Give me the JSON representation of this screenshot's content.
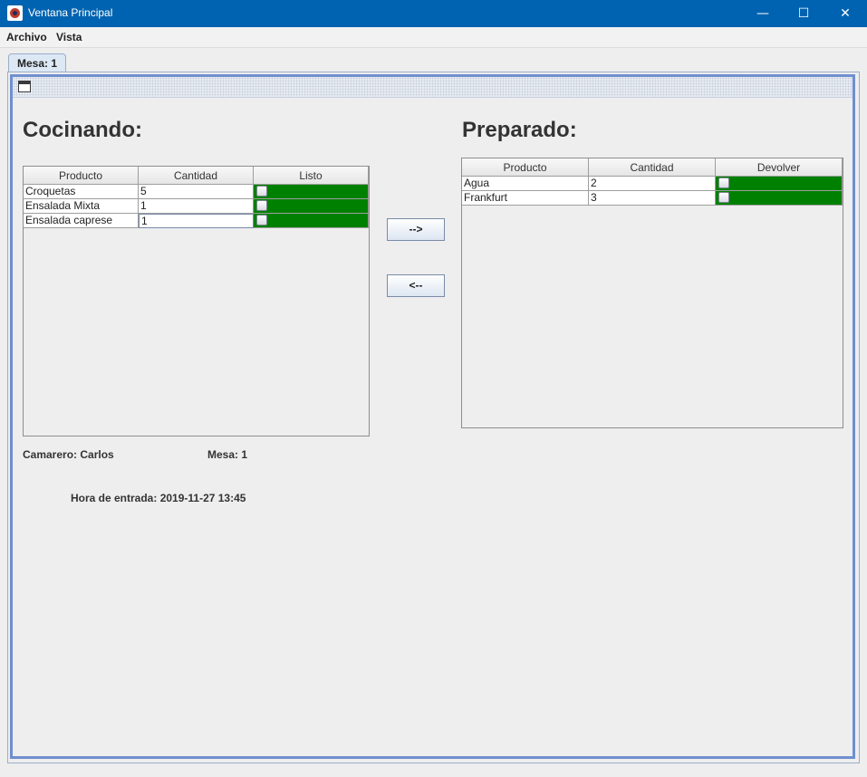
{
  "window": {
    "title": "Ventana Principal",
    "minimize": "—",
    "maximize": "☐",
    "close": "✕"
  },
  "menu": {
    "items": [
      "Archivo",
      "Vista"
    ]
  },
  "tabs": [
    "Mesa: 1"
  ],
  "cocinando": {
    "heading": "Cocinando:",
    "columns": [
      "Producto",
      "Cantidad",
      "Listo"
    ],
    "rows": [
      {
        "producto": "Croquetas",
        "cantidad": "5"
      },
      {
        "producto": "Ensalada Mixta",
        "cantidad": "1"
      },
      {
        "producto": "Ensalada caprese",
        "cantidad": "1"
      }
    ]
  },
  "preparado": {
    "heading": "Preparado:",
    "columns": [
      "Producto",
      "Cantidad",
      "Devolver"
    ],
    "rows": [
      {
        "producto": "Agua",
        "cantidad": "2"
      },
      {
        "producto": "Frankfurt",
        "cantidad": "3"
      }
    ]
  },
  "buttons": {
    "forward": "-->",
    "back": "<--"
  },
  "info": {
    "camarero": "Camarero: Carlos",
    "mesa": "Mesa: 1",
    "hora": "Hora de entrada: 2019-11-27 13:45"
  },
  "colors": {
    "titlebar": "#0063b1",
    "accent": "#6f8fcf",
    "check_cell": "#008000"
  }
}
